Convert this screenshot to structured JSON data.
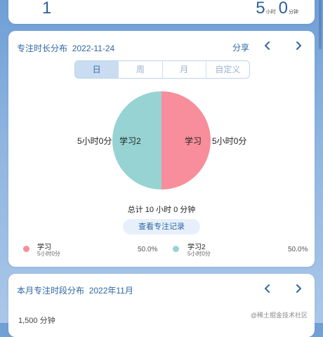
{
  "top_card": {
    "left_value": "1",
    "hours": "5",
    "hours_unit": "小时",
    "minutes": "0",
    "minutes_unit": "分钟"
  },
  "distribution": {
    "title": "专注时长分布",
    "date": "2022-11-24",
    "share_label": "分享",
    "tabs": [
      "日",
      "周",
      "月",
      "自定义"
    ],
    "active_tab": "日",
    "total": "总计 10 小时 0 分钟",
    "view_records": "查看专注记录"
  },
  "chart_data": {
    "type": "pie",
    "slices": [
      {
        "name": "学习",
        "value": 50.0,
        "duration": "5小时0分",
        "color": "#f88e9b"
      },
      {
        "name": "学习2",
        "value": 50.0,
        "duration": "5小时0分",
        "color": "#97d3d3"
      }
    ]
  },
  "legend": [
    {
      "name": "学习",
      "sub": "5小时0分",
      "pct": "50.0%",
      "color": "#f88e9b"
    },
    {
      "name": "学习2",
      "sub": "5小时0分",
      "pct": "50.0%",
      "color": "#97d3d3"
    }
  ],
  "monthly": {
    "title": "本月专注时段分布",
    "month": "2022年11月",
    "value": "1,500 分钟"
  },
  "watermark": "@稀土掘金技术社区"
}
